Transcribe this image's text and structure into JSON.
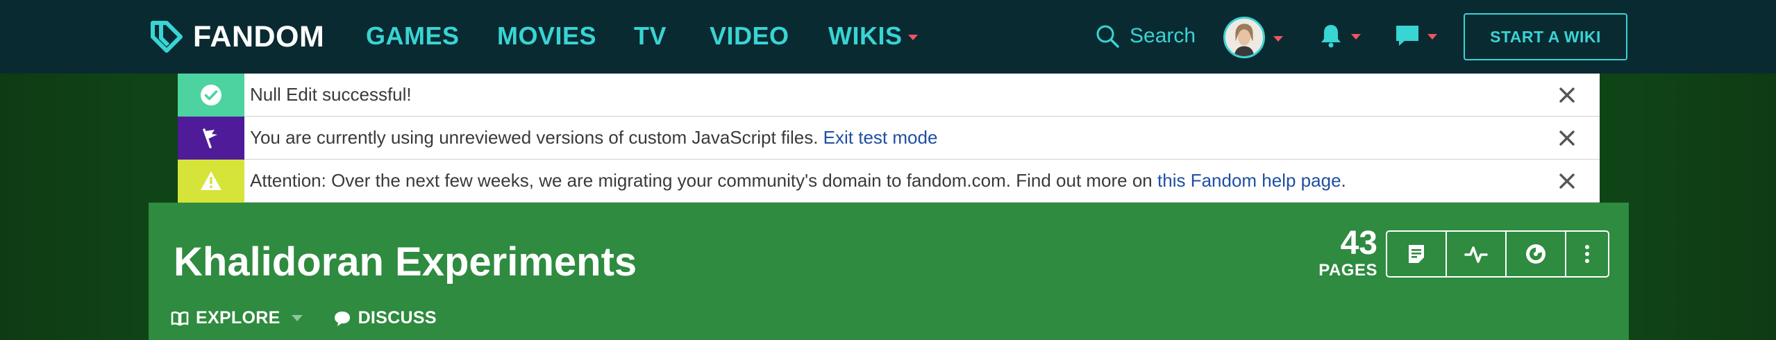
{
  "global_nav": {
    "logo_text": "FANDOM",
    "links": [
      {
        "label": "GAMES"
      },
      {
        "label": "MOVIES"
      },
      {
        "label": "TV"
      },
      {
        "label": "VIDEO"
      },
      {
        "label": "WIKIS"
      }
    ],
    "search_label": "Search",
    "start_wiki_label": "START A WIKI",
    "accent_color": "#39d4d4",
    "caret_color": "#f05463",
    "background_color": "#0a2a31"
  },
  "banners": [
    {
      "type": "success",
      "icon": "checkmark-icon",
      "color": "#4cd3a0",
      "text": "Null Edit successful!",
      "link": ""
    },
    {
      "type": "notify",
      "icon": "flag-icon",
      "color": "#4f1b99",
      "text": "You are currently using unreviewed versions of custom JavaScript files.",
      "link": "Exit test mode",
      "suffix": ""
    },
    {
      "type": "warning",
      "icon": "warning-icon",
      "color": "#d6e43a",
      "text": "Attention: Over the next few weeks, we are migrating your community's domain to fandom.com. Find out more on",
      "link": "this Fandom help page",
      "suffix": "."
    }
  ],
  "community": {
    "title": "Khalidoran Experiments",
    "pages_count": "43",
    "pages_label": "PAGES",
    "background_color": "#2e8b3f",
    "tools": [
      {
        "icon": "add-page-icon"
      },
      {
        "icon": "recent-activity-icon"
      },
      {
        "icon": "insights-icon"
      },
      {
        "icon": "more-options-icon"
      }
    ],
    "local_nav": [
      {
        "label": "EXPLORE",
        "icon": "book-icon"
      },
      {
        "label": "DISCUSS",
        "icon": "speech-bubble-icon"
      }
    ]
  }
}
